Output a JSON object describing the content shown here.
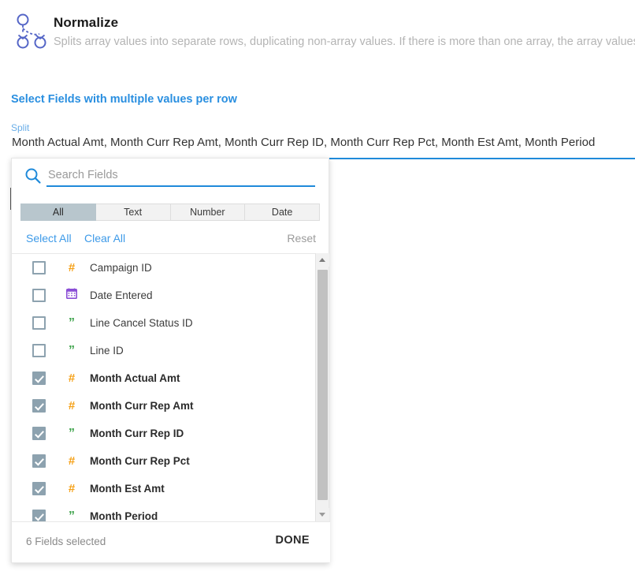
{
  "header": {
    "icon": "normalize-split-nodes-icon",
    "title": "Normalize",
    "description": "Splits array values into separate rows, duplicating non-array values. If there is more than one array, the array values w"
  },
  "form": {
    "section_title": "Select Fields with multiple values per row",
    "split_label": "Split",
    "split_value": "Month Actual Amt, Month Curr Rep Amt, Month Curr Rep ID, Month Curr Rep Pct, Month Est Amt, Month Period"
  },
  "dropdown": {
    "search": {
      "icon": "search-icon",
      "placeholder": "Search Fields",
      "value": ""
    },
    "tabs": [
      {
        "label": "All",
        "active": true
      },
      {
        "label": "Text",
        "active": false
      },
      {
        "label": "Number",
        "active": false
      },
      {
        "label": "Date",
        "active": false
      }
    ],
    "actions": {
      "select_all": "Select All",
      "clear_all": "Clear All",
      "reset": "Reset"
    },
    "fields": [
      {
        "label": "Campaign ID",
        "type": "number",
        "checked": false
      },
      {
        "label": "Date Entered",
        "type": "date",
        "checked": false
      },
      {
        "label": "Line Cancel Status ID",
        "type": "text",
        "checked": false
      },
      {
        "label": "Line ID",
        "type": "text",
        "checked": false
      },
      {
        "label": "Month Actual Amt",
        "type": "number",
        "checked": true
      },
      {
        "label": "Month Curr Rep Amt",
        "type": "number",
        "checked": true
      },
      {
        "label": "Month Curr Rep ID",
        "type": "text",
        "checked": true
      },
      {
        "label": "Month Curr Rep Pct",
        "type": "number",
        "checked": true
      },
      {
        "label": "Month Est Amt",
        "type": "number",
        "checked": true
      },
      {
        "label": "Month Period",
        "type": "text",
        "checked": true
      }
    ],
    "footer": {
      "count_text": "6 Fields selected",
      "done_label": "DONE"
    },
    "scrollbar": {
      "up_icon": "chevron-up-icon",
      "down_icon": "chevron-down-icon"
    }
  },
  "colors": {
    "accent_blue": "#1f8ada",
    "link_blue": "#3d9ae8",
    "checkbox_fill": "#8da2af",
    "tab_active": "#b8c6cd",
    "type_number": "#f5a118",
    "type_text": "#3ea34b",
    "type_date": "#8b4fd6"
  }
}
